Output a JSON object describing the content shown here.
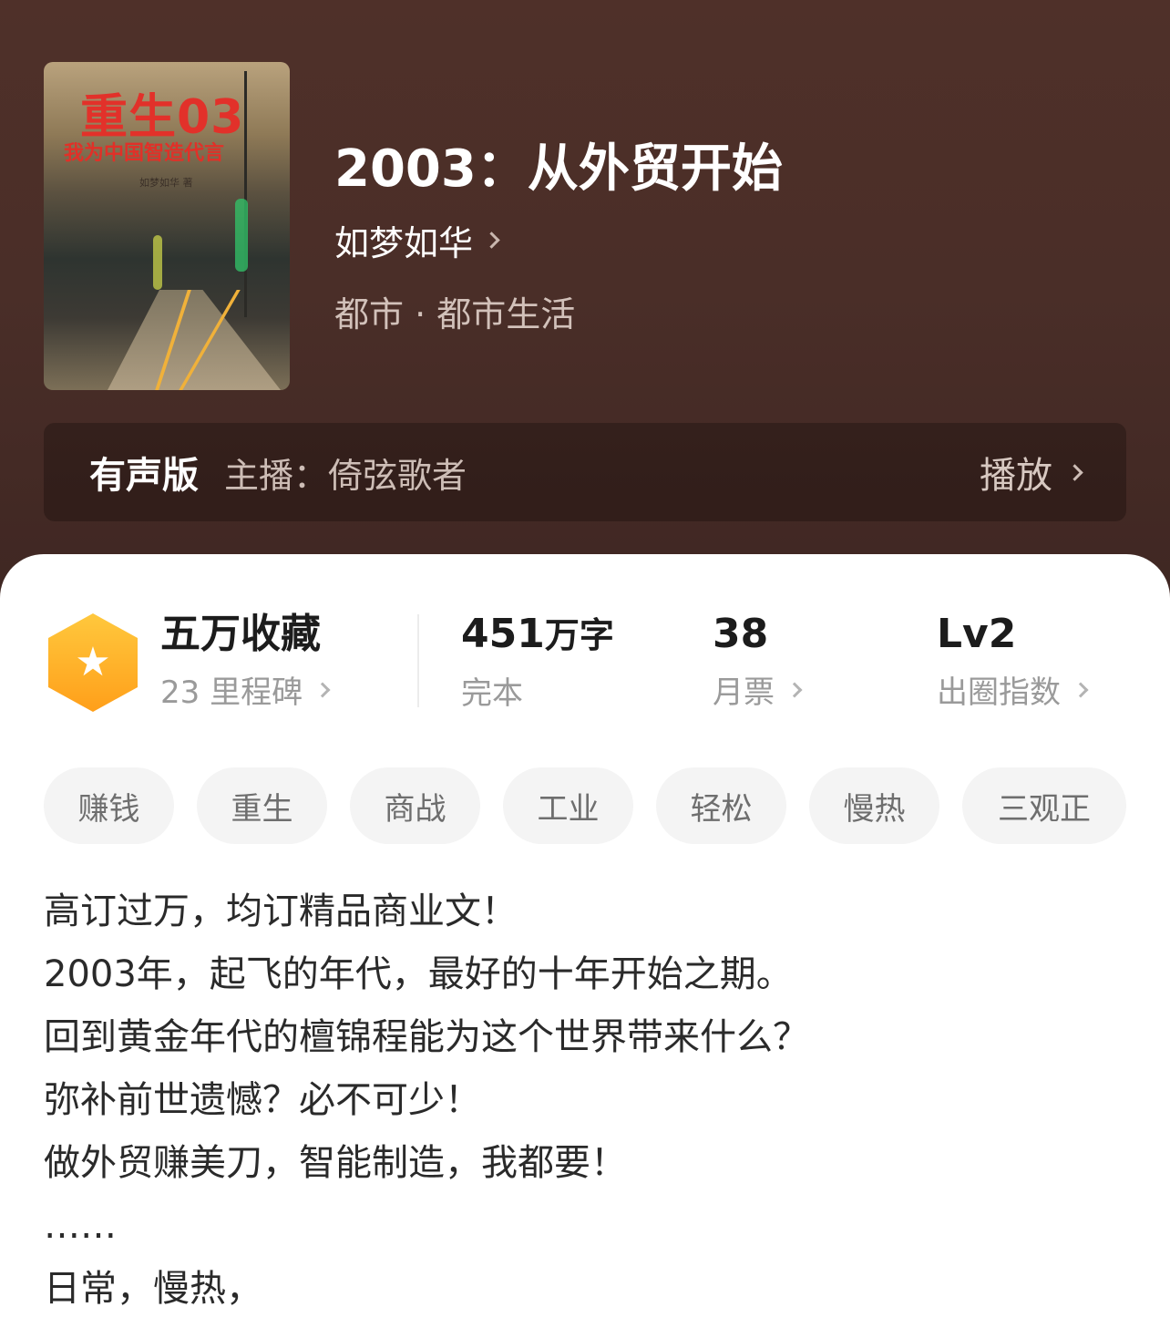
{
  "book": {
    "title": "2003：从外贸开始",
    "author": "如梦如华",
    "genre": "都市 · 都市生活",
    "cover": {
      "title": "重生03",
      "subtitle": "我为中国智造代言",
      "author": "如梦如华 著"
    }
  },
  "audio": {
    "label": "有声版",
    "host": "主播：倚弦歌者",
    "play": "播放"
  },
  "stats": {
    "collect": {
      "main": "五万收藏",
      "sub": "23 里程碑"
    },
    "words": {
      "number": "451",
      "unit": "万字",
      "sub": "完本"
    },
    "tickets": {
      "main": "38",
      "sub": "月票"
    },
    "level": {
      "main": "Lv2",
      "sub": "出圈指数"
    }
  },
  "tags": [
    "赚钱",
    "重生",
    "商战",
    "工业",
    "轻松",
    "慢热",
    "三观正"
  ],
  "description": [
    "高订过万，均订精品商业文！",
    "2003年，起飞的年代，最好的十年开始之期。",
    "回到黄金年代的檀锦程能为这个世界带来什么？",
    "弥补前世遗憾？必不可少！",
    "做外贸赚美刀，智能制造，我都要！",
    "……",
    "日常，慢热，"
  ],
  "icons": {
    "badge": "star-hexagon-icon",
    "chevron": "chevron-right-icon"
  },
  "colors": {
    "header_bg": "#4a2e28",
    "badge_top": "#ffc83d",
    "badge_bottom": "#ff9f1a",
    "cover_title": "#e2312a"
  }
}
